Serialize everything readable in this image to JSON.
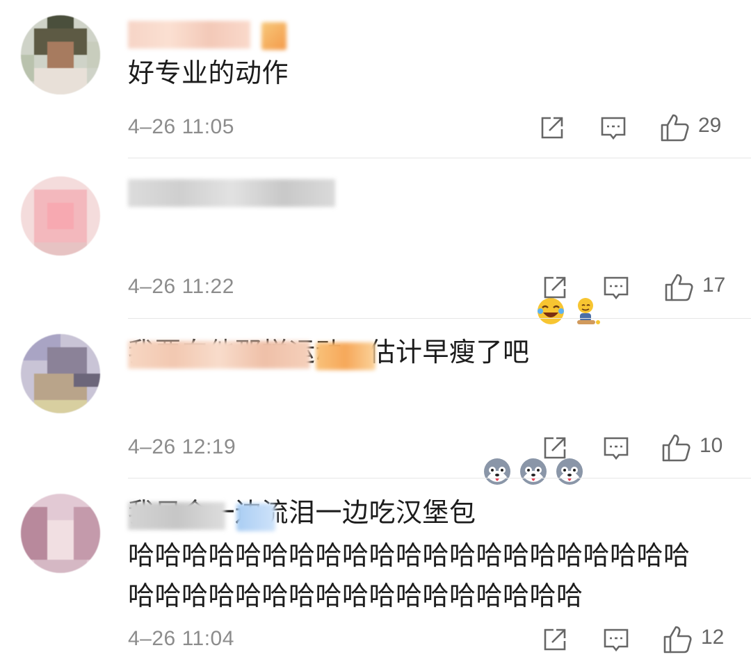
{
  "comments": [
    {
      "text": "好专业的动作",
      "time": "4–26 11:05",
      "likes": "29"
    },
    {
      "text": "我要向他那样运动，估计早瘦了吧",
      "time": "4–26 11:22",
      "likes": "17"
    },
    {
      "text": "我只会一边流泪一边吃汉堡包",
      "time": "4–26 12:19",
      "likes": "10"
    },
    {
      "text": "哈哈哈哈哈哈哈哈哈哈哈哈哈哈哈哈哈哈哈哈哈哈哈哈哈哈哈哈哈哈哈哈哈哈哈哈哈哈",
      "time": "4–26 11:04",
      "likes": "12"
    }
  ],
  "icons": {
    "repost": "repost-icon",
    "reply": "comment-icon",
    "like": "thumbs-up-icon",
    "emoji_laugh_cry": "laugh-cry-emoji",
    "emoji_doge_sit": "sitting-figure-emoji",
    "emoji_husky": "husky-emoji"
  },
  "colors": {
    "text": "#1c1c1c",
    "meta": "#8c8c8c",
    "divider": "#e6e6e6",
    "icon": "#666666"
  }
}
